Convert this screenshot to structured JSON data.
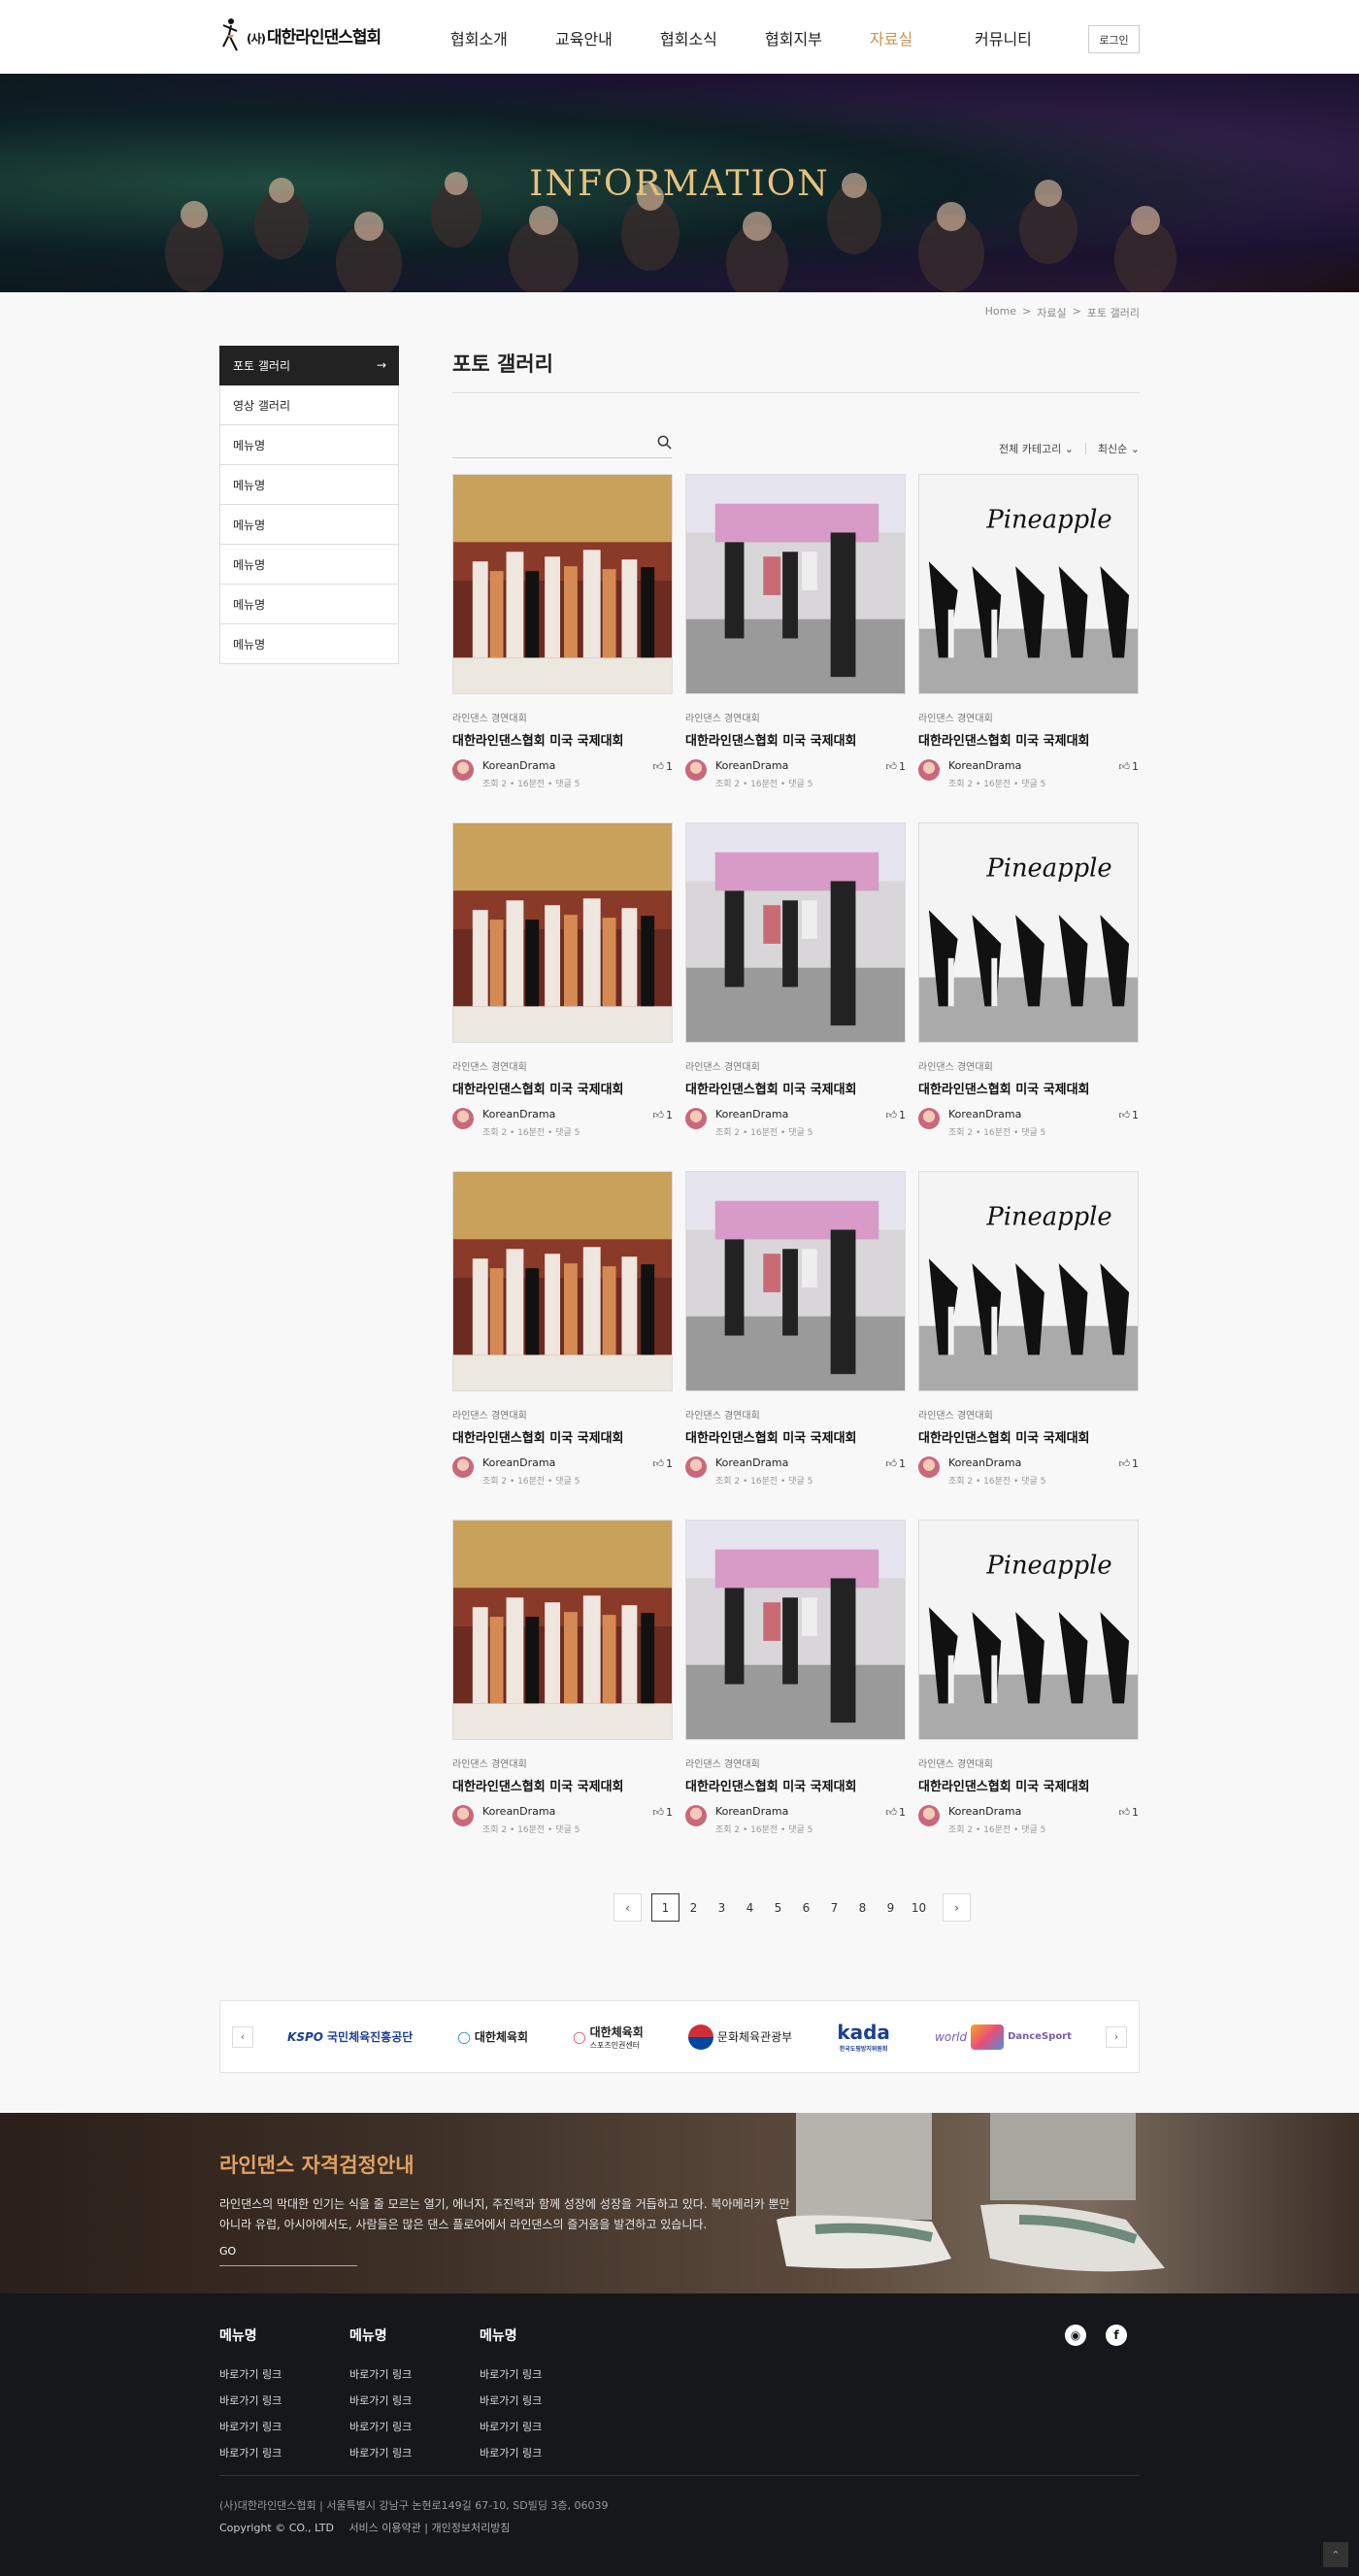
{
  "header": {
    "logo_prefix": "(사)",
    "logo_text": "대한라인댄스협회",
    "nav": [
      "협회소개",
      "교육안내",
      "협회소식",
      "협회지부",
      "자료실",
      "커뮤니티"
    ],
    "active_nav": "자료실",
    "login_label": "로그인"
  },
  "hero": {
    "title": "INFORMATION"
  },
  "breadcrumb": [
    "Home",
    ">",
    "자료실",
    ">",
    "포토 갤러리"
  ],
  "sidebar": {
    "items": [
      {
        "label": "포토 갤러리"
      },
      {
        "label": "영상 갤러리"
      },
      {
        "label": "메뉴명"
      },
      {
        "label": "메뉴명"
      },
      {
        "label": "메뉴명"
      },
      {
        "label": "메뉴명"
      },
      {
        "label": "메뉴명"
      },
      {
        "label": "메뉴명"
      }
    ]
  },
  "page_title": "포토 갤러리",
  "search": {
    "placeholder": ""
  },
  "filters": {
    "category": "전체 카테고리",
    "sort": "최신순"
  },
  "gallery": {
    "category": "라인댄스 경연대회",
    "title": "대한라인댄스협회 미국 국제대회",
    "author": "KoreanDrama",
    "stats": "조회 2 • 16분전 • 댓글 5",
    "likes": "1",
    "image_caption": "Pineapple"
  },
  "pagination": {
    "pages": [
      "1",
      "2",
      "3",
      "4",
      "5",
      "6",
      "7",
      "8",
      "9",
      "10"
    ],
    "current": "1"
  },
  "partners": [
    {
      "name": "국민체육진흥공단",
      "mark": "KSPO"
    },
    {
      "name": "대한체육회",
      "mark": ""
    },
    {
      "name": "대한체육회",
      "mark": "스포츠인권센터"
    },
    {
      "name": "문화체육관광부",
      "mark": ""
    },
    {
      "name": "한국도핑방지위원회",
      "mark": "kada"
    },
    {
      "name": "DanceSport",
      "mark": "world"
    }
  ],
  "banner": {
    "title": "라인댄스 자격검정안내",
    "desc_line1": "라인댄스의 막대한 인기는 식을 줄 모르는 열기, 에너지, 주진력과 함께 성장에 성장을 거듭하고 있다. 북아메리카 뿐만",
    "desc_line2": "아니라 유럽, 아시아에서도, 사람들은 많은 댄스 플로어에서 라인댄스의 즐거움을 발견하고 있습니다.",
    "go_label": "GO"
  },
  "footer": {
    "columns": [
      {
        "heading": "메뉴명",
        "links": [
          "바로가기 링크",
          "바로가기 링크",
          "바로가기 링크",
          "바로가기 링크"
        ]
      },
      {
        "heading": "메뉴명",
        "links": [
          "바로가기 링크",
          "바로가기 링크",
          "바로가기 링크",
          "바로가기 링크"
        ]
      },
      {
        "heading": "메뉴명",
        "links": [
          "바로가기 링크",
          "바로가기 링크",
          "바로가기 링크",
          "바로가기 링크"
        ]
      }
    ],
    "address": "(사)대한라인댄스협회  |  서울특별시 강남구 논현로149길 67-10, SD빌딩 3층, 06039",
    "copyright": "Copyright © CO., LTD",
    "terms": "서비스 이용약관",
    "divider": "|",
    "privacy": "개인정보처리방침",
    "sns": [
      "github-icon",
      "facebook-icon"
    ]
  },
  "colors": {
    "accent": "#c8965a",
    "banner_title": "#e2a160",
    "footer_bg": "#16171a"
  }
}
